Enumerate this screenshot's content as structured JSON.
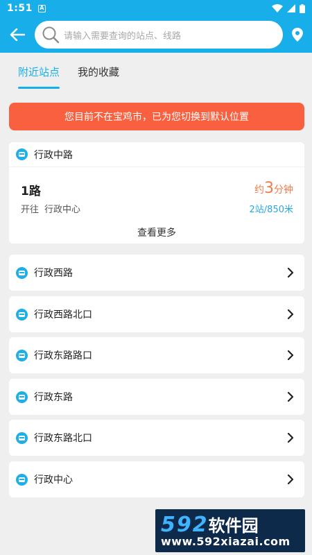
{
  "status": {
    "time": "1:51",
    "notif_glyph": "A"
  },
  "search": {
    "placeholder": "请输入需要查询的站点、线路"
  },
  "tabs": [
    {
      "label": "附近站点",
      "active": true
    },
    {
      "label": "我的收藏",
      "active": false
    }
  ],
  "banner": {
    "text": "您目前不在宝鸡市，已为您切换到默认位置"
  },
  "nearest": {
    "station": "行政中路",
    "route": "1路",
    "direction_label": "开往",
    "destination": "行政中心",
    "eta_prefix": "约",
    "eta_value": "3",
    "eta_suffix": "分钟",
    "distance": "2站/850米",
    "more_label": "查看更多"
  },
  "stations": [
    {
      "name": "行政西路"
    },
    {
      "name": "行政西路北口"
    },
    {
      "name": "行政东路路口"
    },
    {
      "name": "行政东路"
    },
    {
      "name": "行政东路北口"
    },
    {
      "name": "行政中心"
    }
  ],
  "watermark": {
    "brand_digits": "592",
    "brand_cn": "软件园",
    "url": "www.592xiazai.com"
  },
  "colors": {
    "primary": "#18aeea",
    "banner": "#f8603f",
    "eta": "#f07a4a"
  }
}
